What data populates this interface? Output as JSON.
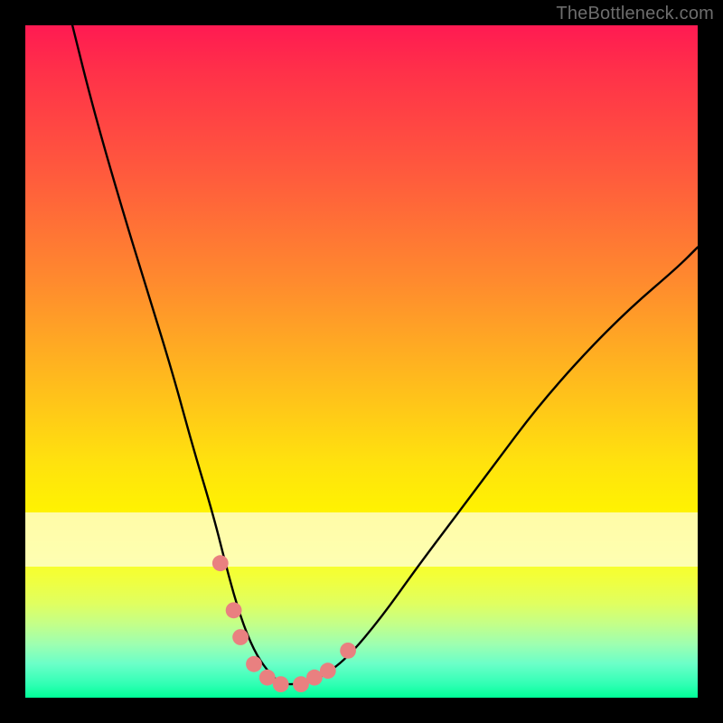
{
  "watermark": {
    "text": "TheBottleneck.com"
  },
  "chart_data": {
    "type": "line",
    "title": "",
    "xlabel": "",
    "ylabel": "",
    "xlim": [
      0,
      100
    ],
    "ylim": [
      0,
      100
    ],
    "grid": false,
    "legend": false,
    "series": [
      {
        "name": "bottleneck-curve",
        "x": [
          7,
          10,
          14,
          18,
          22,
          25,
          28,
          30,
          32,
          34,
          36,
          38,
          41,
          44,
          48,
          53,
          58,
          64,
          70,
          76,
          83,
          90,
          97,
          100
        ],
        "values": [
          100,
          88,
          74,
          61,
          48,
          37,
          27,
          19,
          12,
          7,
          4,
          2,
          2,
          3,
          6,
          12,
          19,
          27,
          35,
          43,
          51,
          58,
          64,
          67
        ]
      }
    ],
    "markers": [
      {
        "name": "marker-left-upper",
        "x": 29,
        "y": 20
      },
      {
        "name": "marker-left-mid",
        "x": 31,
        "y": 13
      },
      {
        "name": "marker-left-low",
        "x": 32,
        "y": 9
      },
      {
        "name": "marker-trough-1",
        "x": 34,
        "y": 5
      },
      {
        "name": "marker-trough-2",
        "x": 36,
        "y": 3
      },
      {
        "name": "marker-trough-3",
        "x": 38,
        "y": 2
      },
      {
        "name": "marker-trough-4",
        "x": 41,
        "y": 2
      },
      {
        "name": "marker-trough-5",
        "x": 43,
        "y": 3
      },
      {
        "name": "marker-right-low",
        "x": 45,
        "y": 4
      },
      {
        "name": "marker-right-upper",
        "x": 48,
        "y": 7
      }
    ],
    "marker_style": {
      "color": "#e98080",
      "radius_fraction": 0.012
    }
  }
}
